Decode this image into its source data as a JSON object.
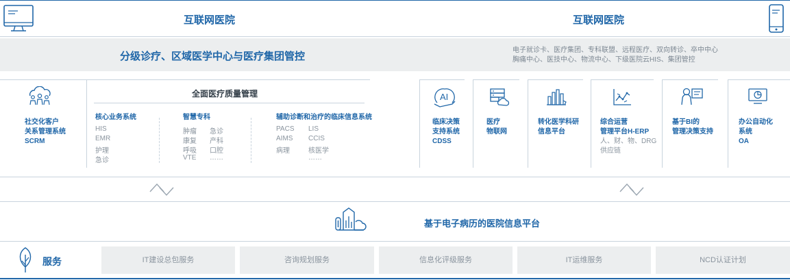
{
  "header": {
    "left_title": "互联网医院",
    "right_title": "互联网医院",
    "left_icon": "monitor-icon",
    "right_icon": "mobile-phone-icon"
  },
  "band": {
    "title": "分级诊疗、区域医学中心与医疗集团管控",
    "note_line1": "电子就诊卡、医疗集团、专科联盟、远程医疗、双向转诊、卒中中心",
    "note_line2": "胸痛中心、医技中心、物流中心、下级医院云HIS、集团管控"
  },
  "scrm": {
    "icon": "people-cloud-icon",
    "line1": "社交化客户",
    "line2": "关系管理系统",
    "line3": "SCRM"
  },
  "quality": {
    "title": "全面医疗质量管理",
    "col1": {
      "title": "核心业务系统",
      "items": [
        "HIS",
        "EMR",
        "护理",
        "急诊"
      ]
    },
    "col2": {
      "title": "智慧专科",
      "items_a": [
        "肿瘤",
        "康复",
        "呼吸",
        "VTE"
      ],
      "items_b": [
        "急诊",
        "产科",
        "口腔",
        "……"
      ]
    },
    "col3": {
      "title": "辅助诊断和治疗的临床信息系统",
      "items_a": [
        "PACS",
        "AIMS",
        "病理"
      ],
      "items_b": [
        "LIS",
        "CCIS",
        "核医学",
        "……"
      ]
    }
  },
  "modules": [
    {
      "icon": "ai-icon",
      "lines": [
        "临床决策",
        "支持系统",
        "CDSS"
      ],
      "sub": []
    },
    {
      "icon": "server-cloud-icon",
      "lines": [
        "医疗",
        "物联网"
      ],
      "sub": []
    },
    {
      "icon": "research-chart-icon",
      "lines": [
        "转化医学科研",
        "信息平台"
      ],
      "sub": []
    },
    {
      "icon": "trend-chart-icon",
      "lines": [
        "综合运营",
        "管理平台H-ERP"
      ],
      "sub": [
        "人、财、物、DRG",
        "供应链"
      ]
    },
    {
      "icon": "person-board-icon",
      "lines": [
        "基于BI的",
        "管理决策支持"
      ],
      "sub": []
    },
    {
      "icon": "office-screen-icon",
      "lines": [
        "办公自动化",
        "系统",
        "OA"
      ],
      "sub": []
    }
  ],
  "platform": {
    "icon": "data-cloud-icon",
    "title": "基于电子病历的医院信息平台"
  },
  "services": {
    "icon": "leaf-icon",
    "label": "服务",
    "items": [
      "IT建设总包服务",
      "咨询规划服务",
      "信息化评级服务",
      "IT运维服务",
      "NCD认证计划"
    ]
  },
  "colors": {
    "accent": "#1f66a8",
    "band_gray": "#eceeef",
    "line": "#c8d3dd"
  }
}
